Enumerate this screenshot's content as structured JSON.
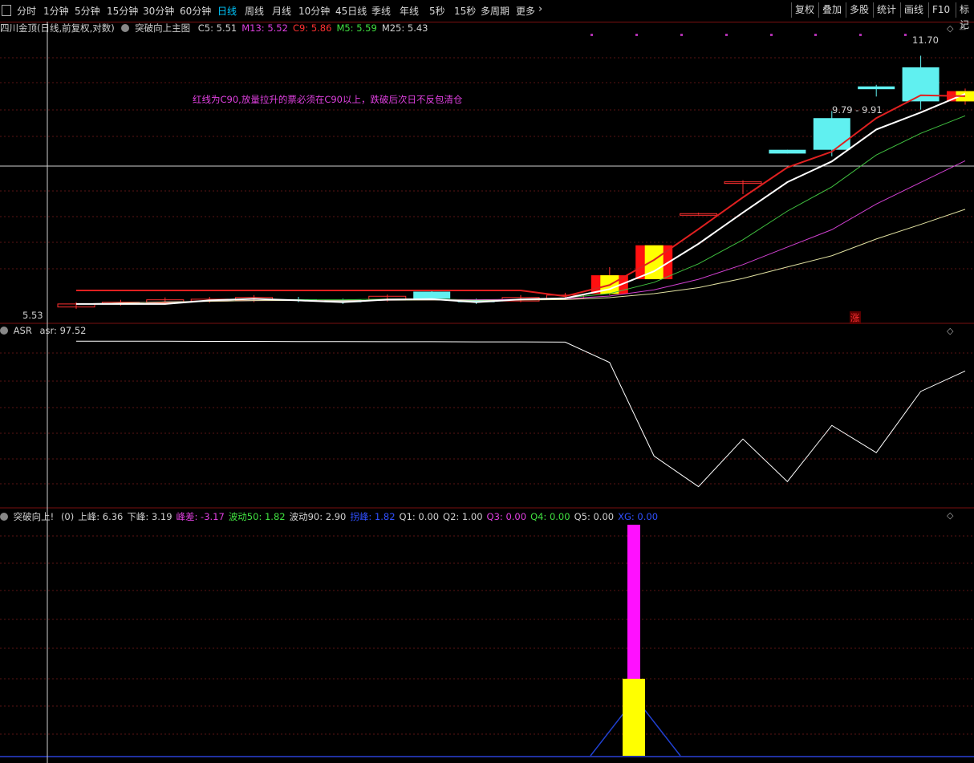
{
  "toolbar": {
    "corner_icon": "window-icon",
    "periods": [
      "分时",
      "1分钟",
      "5分钟",
      "15分钟",
      "30分钟",
      "60分钟",
      "日线",
      "周线",
      "月线",
      "10分钟",
      "45日线",
      "季线",
      "年线",
      "5秒",
      "15秒",
      "多周期",
      "更多"
    ],
    "active_period": "日线",
    "more_icon": "chevron-right-icon",
    "right_buttons": [
      "复权",
      "叠加",
      "多股",
      "统计",
      "画线",
      "F10",
      "标记"
    ]
  },
  "main_panel": {
    "stock_title": "四川金顶(日线,前复权,对数)",
    "indicator_name": "突破向上主图",
    "values": [
      {
        "label": "C5: 5.51",
        "color": "#d0d0d0"
      },
      {
        "label": "M13: 5.52",
        "color": "#e040e0"
      },
      {
        "label": "C9: 5.86",
        "color": "#ff3030"
      },
      {
        "label": "M5: 5.59",
        "color": "#40e040"
      },
      {
        "label": "M25: 5.43",
        "color": "#d0d0d0"
      }
    ],
    "note": "红线为C90,放量拉升的票必须在C90以上，跌破后次日不反包清仓",
    "high_label": "11.70",
    "low_label": "5.53",
    "range_label": "9.79 - 9.91",
    "zhang_label": "涨",
    "chart_data": {
      "type": "candlestick",
      "scale": "log",
      "ylim": [
        5.3,
        12.5
      ],
      "candles": [
        {
          "o": 5.5,
          "c": 5.55,
          "h": 5.58,
          "l": 5.47
        },
        {
          "o": 5.55,
          "c": 5.58,
          "h": 5.62,
          "l": 5.52
        },
        {
          "o": 5.57,
          "c": 5.62,
          "h": 5.66,
          "l": 5.55
        },
        {
          "o": 5.6,
          "c": 5.63,
          "h": 5.67,
          "l": 5.57
        },
        {
          "o": 5.61,
          "c": 5.66,
          "h": 5.7,
          "l": 5.58
        },
        {
          "o": 5.63,
          "c": 5.61,
          "h": 5.67,
          "l": 5.58
        },
        {
          "o": 5.62,
          "c": 5.58,
          "h": 5.64,
          "l": 5.55
        },
        {
          "o": 5.62,
          "c": 5.68,
          "h": 5.71,
          "l": 5.59
        },
        {
          "o": 5.76,
          "c": 5.64,
          "h": 5.78,
          "l": 5.62
        },
        {
          "o": 5.62,
          "c": 5.58,
          "h": 5.64,
          "l": 5.55
        },
        {
          "o": 5.6,
          "c": 5.66,
          "h": 5.7,
          "l": 5.58
        },
        {
          "o": 5.64,
          "c": 5.7,
          "h": 5.74,
          "l": 5.62
        },
        {
          "o": 5.72,
          "c": 6.05,
          "h": 6.2,
          "l": 5.7
        },
        {
          "o": 5.98,
          "c": 6.62,
          "h": 6.62,
          "l": 5.98
        },
        {
          "o": 7.28,
          "c": 7.28,
          "h": 7.3,
          "l": 7.26
        },
        {
          "o": 8.01,
          "c": 8.01,
          "h": 8.05,
          "l": 7.72
        },
        {
          "o": 8.82,
          "c": 8.72,
          "h": 8.82,
          "l": 8.72
        },
        {
          "o": 9.7,
          "c": 8.82,
          "h": 9.91,
          "l": 8.65
        },
        {
          "o": 10.67,
          "c": 10.58,
          "h": 10.72,
          "l": 10.35
        },
        {
          "o": 11.3,
          "c": 10.2,
          "h": 11.7,
          "l": 9.95
        },
        {
          "o": 10.2,
          "c": 10.52,
          "h": 10.6,
          "l": 10.1
        }
      ]
    }
  },
  "asr_panel": {
    "title": "ASR",
    "value_label": "asr: 97.52",
    "chart_data": {
      "type": "line",
      "ylim": [
        0,
        100
      ],
      "values": [
        97.5,
        97.5,
        97.5,
        97.4,
        97.4,
        97.3,
        97.3,
        97.2,
        97.2,
        97.1,
        97.1,
        97.0,
        85,
        30,
        12,
        40,
        15,
        48,
        32,
        68,
        80
      ]
    }
  },
  "bottom_panel": {
    "title": "突破向上!",
    "values": [
      {
        "label": "(0)",
        "color": "#d0d0d0"
      },
      {
        "label": "上峰: 6.36",
        "color": "#d0d0d0"
      },
      {
        "label": "下峰: 3.19",
        "color": "#d0d0d0"
      },
      {
        "label": "峰差: -3.17",
        "color": "#e040e0"
      },
      {
        "label": "波动50: 1.82",
        "color": "#40e040"
      },
      {
        "label": "波动90: 2.90",
        "color": "#d0d0d0"
      },
      {
        "label": "拐峰: 1.82",
        "color": "#3050ff"
      },
      {
        "label": "Q1: 0.00",
        "color": "#d0d0d0"
      },
      {
        "label": "Q2: 1.00",
        "color": "#d0d0d0"
      },
      {
        "label": "Q3: 0.00",
        "color": "#e040e0"
      },
      {
        "label": "Q4: 0.00",
        "color": "#40e040"
      },
      {
        "label": "Q5: 0.00",
        "color": "#d0d0d0"
      },
      {
        "label": "XG: 0.00",
        "color": "#3050ff"
      }
    ]
  },
  "colors": {
    "frame": "#7a1010",
    "up_red": "#ff1010",
    "yellow": "#ffff00",
    "cyan": "#60f0f0",
    "magenta": "#ff10ff"
  }
}
